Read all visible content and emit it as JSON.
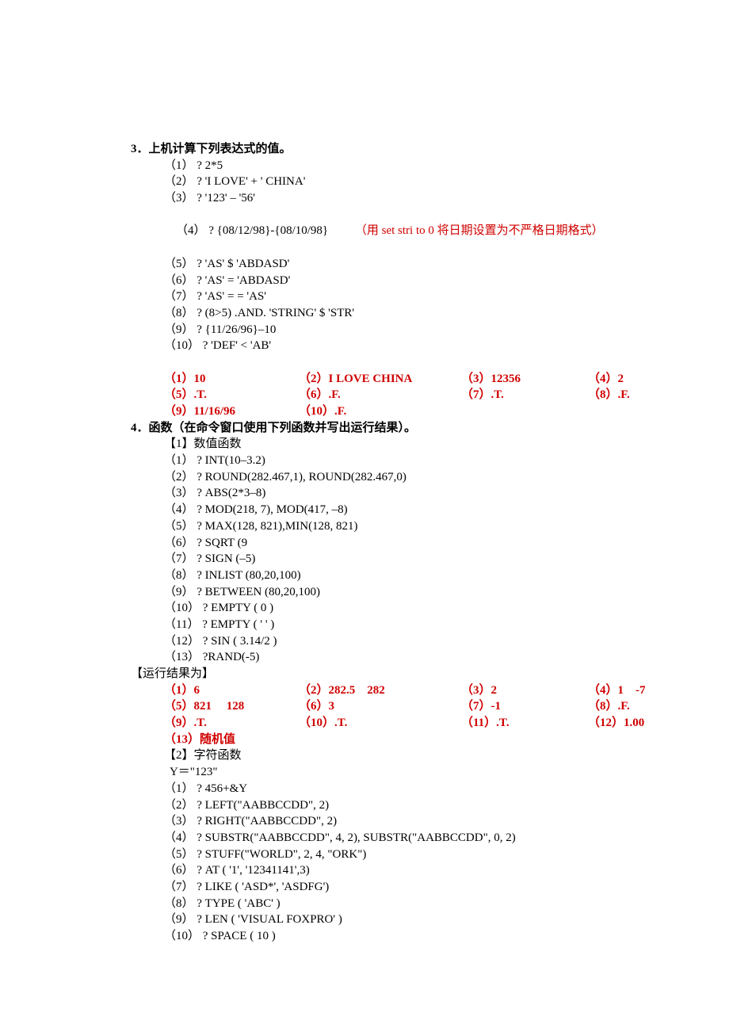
{
  "s3": {
    "title": "3．上机计算下列表达式的值。",
    "q": [
      "（1） ? 2*5",
      "（2） ? 'I LOVE' + ' CHINA'",
      "（3） ? '123' – '56'",
      "（4） ? {08/12/98}-{08/10/98}",
      "（5） ? 'AS' $ 'ABDASD'",
      "（6） ? 'AS' = 'ABDASD'",
      "（7） ? 'AS' = = 'AS'",
      "（8） ? (8>5) .AND. 'STRING' $ 'STR'",
      "（9） ? {11/26/96}–10",
      "（10） ? 'DEF' < 'AB'"
    ],
    "note": "（用 set stri to 0 将日期设置为不严格日期格式）",
    "ans": [
      [
        "（1）10",
        "（2）I LOVE CHINA",
        "（3）12356",
        "（4）2"
      ],
      [
        "（5）.T.",
        "（6）.F.",
        "（7）.T.",
        "（8）.F."
      ],
      [
        "（9）11/16/96",
        "（10）.F.",
        "",
        ""
      ]
    ]
  },
  "s4": {
    "title": "4．函数（在命令窗口使用下列函数并写出运行结果）。",
    "p1title": "【1】数值函数",
    "p1q": [
      "（1） ? INT(10–3.2)",
      "（2） ? ROUND(282.467,1), ROUND(282.467,0)",
      "（3） ? ABS(2*3–8)",
      "（4） ? MOD(218, 7), MOD(417, –8)",
      "（5） ? MAX(128, 821),MIN(128, 821)",
      "（6） ? SQRT (9",
      "（7） ? SIGN (–5)",
      "（8） ? INLIST (80,20,100)",
      "（9） ? BETWEEN (80,20,100)",
      "（10） ? EMPTY ( 0 )",
      "（11） ? EMPTY ( ' ' )",
      "（12） ? SIN ( 3.14/2 )",
      "（13） ?RAND(-5)"
    ],
    "runhead": "【运行结果为】",
    "p1ans": [
      [
        "（1）6",
        "（2）282.5    282",
        "（3）2",
        "（4）1    -7"
      ],
      [
        "（5）821     128",
        "（6）3",
        "（7）-1",
        "（8）.F."
      ],
      [
        "（9）.T.",
        "（10）.T.",
        "（11）.T.",
        "（12）1.00"
      ],
      [
        "（13）随机值",
        "",
        "",
        ""
      ]
    ],
    "p2title": "【2】字符函数",
    "p2y": "  Y＝\"123\"",
    "p2q": [
      "（1） ? 456+&Y",
      "（2） ? LEFT(\"AABBCCDD\", 2)",
      "（3） ? RIGHT(\"AABBCCDD\", 2)",
      "（4） ? SUBSTR(\"AABBCCDD\", 4, 2), SUBSTR(\"AABBCCDD\", 0, 2)",
      "（5） ? STUFF(\"WORLD\", 2, 4, \"ORK\")",
      "（6） ? AT ( '1', '12341141',3)",
      "（7） ? LIKE ( 'ASD*', 'ASDFG')",
      "（8） ? TYPE ( 'ABC' )",
      "（9） ? LEN ( 'VISUAL FOXPRO' )",
      "（10） ? SPACE ( 10 )"
    ]
  }
}
